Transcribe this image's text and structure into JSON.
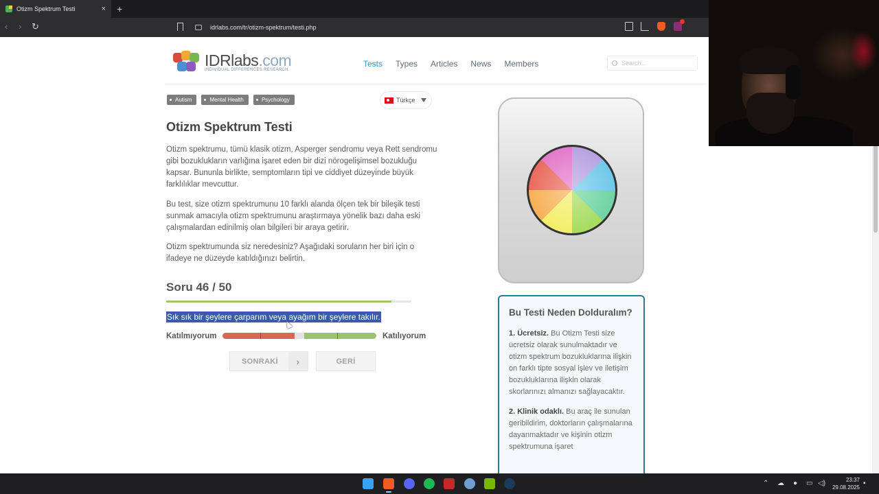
{
  "browser": {
    "tab_title": "Otizm Spektrum Testi",
    "tab_close": "×",
    "new_tab": "+",
    "url": "idrlabs.com/tr/otizm-spektrum/testi.php"
  },
  "site": {
    "logo_name": "IDRlabs",
    "logo_suffix": ".com",
    "logo_tagline": "INDIVIDUAL DIFFERENCES RESEARCH",
    "nav": [
      {
        "label": "Tests",
        "active": true
      },
      {
        "label": "Types"
      },
      {
        "label": "Articles"
      },
      {
        "label": "News"
      },
      {
        "label": "Members"
      }
    ],
    "search_placeholder": "Search..."
  },
  "tags": [
    "Autism",
    "Mental Health",
    "Psychology"
  ],
  "language": "Türkçe",
  "test": {
    "title": "Otizm Spektrum Testi",
    "paragraphs": [
      "Otizm spektrumu, tümü klasik otizm, Asperger sendromu veya Rett sendromu gibi bozuklukların varlığına işaret eden bir dizi nörogelişimsel bozukluğu kapsar. Bununla birlikte, semptomların tipi ve ciddiyet düzeyinde büyük farklılıklar mevcuttur.",
      "Bu test, size otizm spektrumunu 10 farklı alanda ölçen tek bir bileşik testi sunmak amacıyla otizm spektrumunu araştırmaya yönelik bazı daha eski çalışmalardan edinilmiş olan bilgileri bir araya getirir.",
      "Otizm spektrumunda siz neredesiniz? Aşağıdaki soruların her biri için o ifadeye ne düzeyde katıldığınızı belirtin."
    ],
    "question_counter": "Soru 46 / 50",
    "progress": 0.92,
    "question_text": "Sık sık bir şeylere çarparım veya ayağım bir şeylere takılır.",
    "disagree_label": "Katılmıyorum",
    "agree_label": "Katılıyorum",
    "next_label": "SONRAKİ",
    "next_chevron": "›",
    "back_label": "GERİ"
  },
  "sidebar": {
    "box_title": "Bu Testi Neden Dolduralım?",
    "items": [
      {
        "heading": "1. Ücretsiz.",
        "text": " Bu Otizm Testi size ücretsiz olarak sunulmaktadır ve otizm spektrum bozukluklarına ilişkin on farklı tipte sosyal işlev ve iletişim bozukluklarına ilişkin olarak skorlarınızı almanızı sağlayacaktır."
      },
      {
        "heading": "2. Klinik odaklı.",
        "text": " Bu araç ile sunulan geribildirim, doktorların çalışmalarına dayanmaktadır ve kişinin otizm spektrumuna işaret"
      }
    ]
  },
  "taskbar": {
    "time": "23:37",
    "date": "29.08.2025"
  },
  "colors": {
    "accent_nav": "#2a9bc7",
    "progress": "#a0c56e",
    "scale_disagree": "#d9675c",
    "scale_agree": "#9cc26a",
    "selection": "#3b5ba9",
    "info_border": "#2c7a94"
  }
}
